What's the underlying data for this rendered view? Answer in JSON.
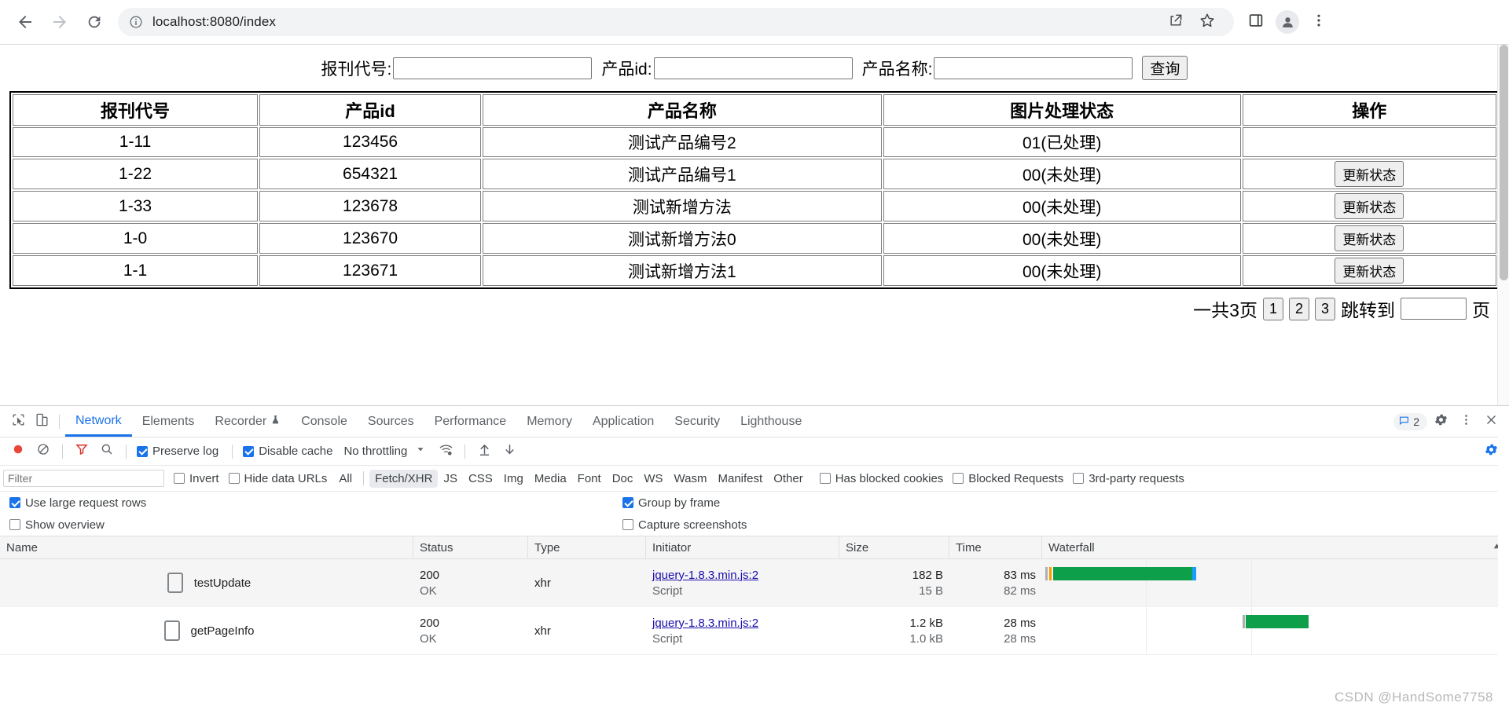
{
  "browser": {
    "url": "localhost:8080/index",
    "icons": {
      "back": "back-arrow-icon",
      "forward": "forward-arrow-icon",
      "reload": "reload-icon",
      "info": "site-info-icon",
      "share": "share-icon",
      "bookmark": "star-icon",
      "sidepanel": "side-panel-icon",
      "profile": "profile-avatar-icon",
      "menu": "three-dot-menu-icon"
    }
  },
  "search_form": {
    "label_code": "报刊代号:",
    "label_product_id": "产品id:",
    "label_product_name": "产品名称:",
    "value_code": "",
    "value_product_id": "",
    "value_product_name": "",
    "query_button": "查询"
  },
  "table": {
    "headers": [
      "报刊代号",
      "产品id",
      "产品名称",
      "图片处理状态",
      "操作"
    ],
    "rows": [
      {
        "code": "1-11",
        "product_id": "123456",
        "product_name": "测试产品编号2",
        "status": "01(已处理)",
        "action": ""
      },
      {
        "code": "1-22",
        "product_id": "654321",
        "product_name": "测试产品编号1",
        "status": "00(未处理)",
        "action": "更新状态"
      },
      {
        "code": "1-33",
        "product_id": "123678",
        "product_name": "测试新增方法",
        "status": "00(未处理)",
        "action": "更新状态"
      },
      {
        "code": "1-0",
        "product_id": "123670",
        "product_name": "测试新增方法0",
        "status": "00(未处理)",
        "action": "更新状态"
      },
      {
        "code": "1-1",
        "product_id": "123671",
        "product_name": "测试新增方法1",
        "status": "00(未处理)",
        "action": "更新状态"
      }
    ]
  },
  "pagination": {
    "total_label": "一共3页",
    "pages": [
      "1",
      "2",
      "3"
    ],
    "jump_label": "跳转到",
    "jump_value": "",
    "page_suffix": "页"
  },
  "devtools": {
    "tabs": [
      {
        "label": "Network",
        "active": true
      },
      {
        "label": "Elements",
        "active": false
      },
      {
        "label": "Recorder",
        "active": false,
        "badge": "flask-icon"
      },
      {
        "label": "Console",
        "active": false
      },
      {
        "label": "Sources",
        "active": false
      },
      {
        "label": "Performance",
        "active": false
      },
      {
        "label": "Memory",
        "active": false
      },
      {
        "label": "Application",
        "active": false
      },
      {
        "label": "Security",
        "active": false
      },
      {
        "label": "Lighthouse",
        "active": false
      }
    ],
    "issues_count": "2",
    "toolbar": {
      "record_icon": "record-button-icon",
      "clear_icon": "clear-icon",
      "filter_icon": "filter-funnel-icon",
      "search_icon": "search-icon",
      "preserve_log": "Preserve log",
      "preserve_log_checked": true,
      "disable_cache": "Disable cache",
      "disable_cache_checked": true,
      "throttling": "No throttling",
      "wifi_icon": "network-conditions-icon",
      "import_icon": "import-har-icon",
      "export_icon": "export-har-icon",
      "more_icon": "more-options-icon",
      "settings_icon": "settings-gear-icon"
    },
    "filterbar": {
      "filter_placeholder": "Filter",
      "filter_value": "",
      "invert": "Invert",
      "invert_checked": false,
      "hide_data_urls": "Hide data URLs",
      "hide_data_urls_checked": false,
      "types": [
        "All",
        "Fetch/XHR",
        "JS",
        "CSS",
        "Img",
        "Media",
        "Font",
        "Doc",
        "WS",
        "Wasm",
        "Manifest",
        "Other"
      ],
      "selected_type": "Fetch/XHR",
      "has_blocked_cookies": "Has blocked cookies",
      "has_blocked_cookies_checked": false,
      "blocked_requests": "Blocked Requests",
      "blocked_requests_checked": false,
      "third_party": "3rd-party requests",
      "third_party_checked": false
    },
    "options": {
      "use_large_request_rows": "Use large request rows",
      "use_large_request_rows_checked": true,
      "group_by_frame": "Group by frame",
      "group_by_frame_checked": true,
      "show_overview": "Show overview",
      "show_overview_checked": false,
      "capture_screenshots": "Capture screenshots",
      "capture_screenshots_checked": false
    },
    "request_table": {
      "columns": [
        "Name",
        "Status",
        "Type",
        "Initiator",
        "Size",
        "Time",
        "Waterfall"
      ],
      "sort_indicator": "sort-ascending-icon",
      "rows": [
        {
          "name": "testUpdate",
          "status": "200",
          "status_sub": "OK",
          "type": "xhr",
          "initiator": "jquery-1.8.3.min.js:2",
          "initiator_sub": "Script",
          "size": "182 B",
          "size_sub": "15 B",
          "time": "83 ms",
          "time_sub": "82 ms"
        },
        {
          "name": "getPageInfo",
          "status": "200",
          "status_sub": "OK",
          "type": "xhr",
          "initiator": "jquery-1.8.3.min.js:2",
          "initiator_sub": "Script",
          "size": "1.2 kB",
          "size_sub": "1.0 kB",
          "time": "28 ms",
          "time_sub": "28 ms"
        }
      ]
    },
    "watermark": "CSDN @HandSome7758"
  },
  "colors": {
    "accent": "#1a73e8",
    "waterfall_green": "#0e9f4b",
    "waterfall_blue": "#1a9cff",
    "link": "#1a0dab"
  }
}
